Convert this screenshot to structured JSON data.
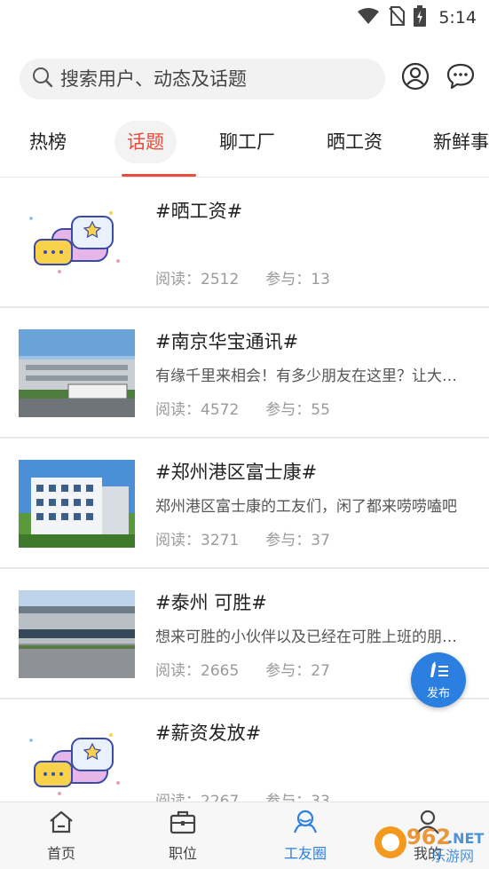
{
  "status_bar": {
    "time": "5:14"
  },
  "search": {
    "placeholder": "搜索用户、动态及话题"
  },
  "tabs": [
    {
      "label": "热榜"
    },
    {
      "label": "话题"
    },
    {
      "label": "聊工厂"
    },
    {
      "label": "晒工资"
    },
    {
      "label": "新鲜事"
    }
  ],
  "active_tab": "话题",
  "topics": [
    {
      "title": "#晒工资#",
      "description": "",
      "read_label": "阅读：2512",
      "join_label": "参与：13",
      "thumb": "chat-bubbles"
    },
    {
      "title": "#南京华宝通讯#",
      "description": "有缘千里来相会！有多少朋友在这里？让大家认识一下吧",
      "read_label": "阅读：4572",
      "join_label": "参与：55",
      "thumb": "factory-building"
    },
    {
      "title": "#郑州港区富士康#",
      "description": "郑州港区富士康的工友们，闲了都来唠唠嗑吧",
      "read_label": "阅读：3271",
      "join_label": "参与：37",
      "thumb": "white-building"
    },
    {
      "title": "#泰州 可胜#",
      "description": "想来可胜的小伙伴以及已经在可胜上班的朋友们",
      "read_label": "阅读：2665",
      "join_label": "参与：27",
      "thumb": "factory-gate"
    },
    {
      "title": "#薪资发放#",
      "description": "",
      "read_label": "阅读：2267",
      "join_label": "参与：33",
      "thumb": "chat-bubbles"
    }
  ],
  "fab": {
    "label": "发布"
  },
  "bottom_nav": [
    {
      "label": "首页",
      "icon": "home-icon"
    },
    {
      "label": "职位",
      "icon": "briefcase-icon"
    },
    {
      "label": "工友圈",
      "icon": "community-icon"
    },
    {
      "label": "我的",
      "icon": "person-icon"
    }
  ],
  "watermark": {
    "text": "962.NET",
    "subtext": "乐游网"
  },
  "colors": {
    "accent": "#e74c3c",
    "nav_active": "#2a7fe0",
    "fab": "#2a7fe0"
  }
}
